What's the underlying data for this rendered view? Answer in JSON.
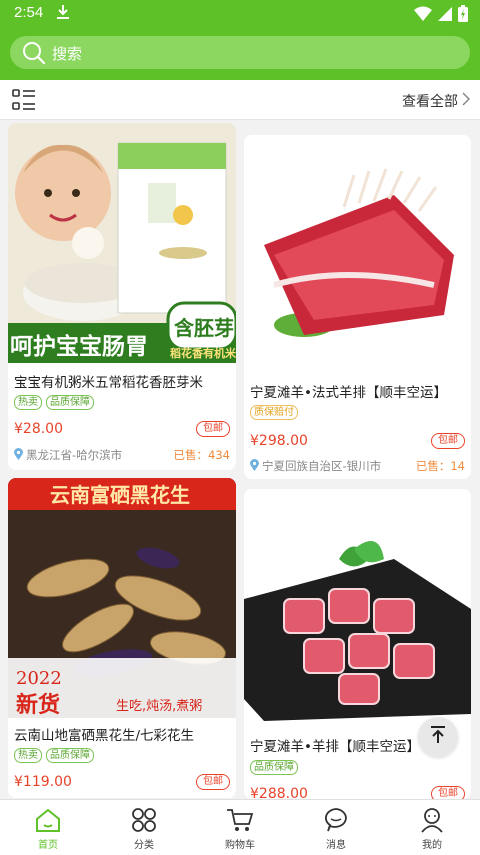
{
  "status_bar": {
    "time": "2:54"
  },
  "search": {
    "placeholder": "搜索"
  },
  "toolbar": {
    "view_all": "查看全部"
  },
  "products": [
    {
      "title": "宝宝有机粥米五常稻花香胚芽米",
      "tags": [
        "热卖",
        "品质保障"
      ],
      "price": "¥28.00",
      "shipping": "包邮",
      "location": "黑龙江省-哈尔滨市",
      "sold": "已售：434",
      "banner_left": "呵护宝宝肠胃",
      "banner_right": "含胚芽",
      "banner_sub": "稻花香有机米"
    },
    {
      "title": "宁夏滩羊•法式羊排【顺丰空运】",
      "tags": [
        "质保赔付"
      ],
      "price": "¥298.00",
      "shipping": "包邮",
      "location": "宁夏回族自治区-银川市",
      "sold": "已售：14"
    },
    {
      "title": "云南山地富硒黑花生/七彩花生",
      "tags": [
        "热卖",
        "品质保障"
      ],
      "price": "¥119.00",
      "shipping": "包邮",
      "banner_top": "云南富硒黑花生",
      "banner_year": "2022",
      "banner_new": "新货",
      "banner_slogan": "生吃,炖汤,煮粥"
    },
    {
      "title": "宁夏滩羊•羊排【顺丰空运】",
      "tags": [
        "品质保障"
      ],
      "price": "¥288.00",
      "shipping": "包邮"
    }
  ],
  "tabbar": [
    {
      "label": "首页",
      "active": true
    },
    {
      "label": "分类"
    },
    {
      "label": "购物车"
    },
    {
      "label": "消息"
    },
    {
      "label": "我的"
    }
  ],
  "colors": {
    "primary": "#5ec127",
    "price": "#e8432a",
    "sold": "#f08a3c"
  }
}
